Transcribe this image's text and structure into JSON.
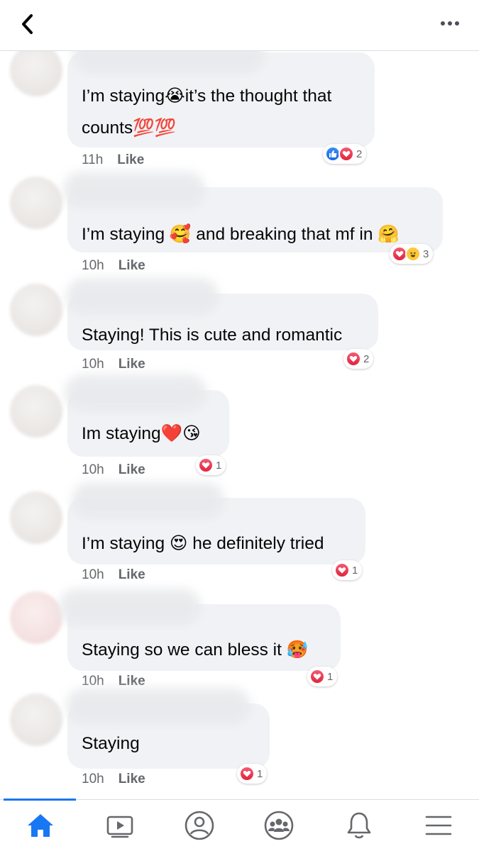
{
  "header": {
    "back_icon": "chevron-left-icon",
    "more_icon": "more-horizontal-icon"
  },
  "comments": [
    {
      "lines": [
        "I’m staying😭it’s the thought that",
        "counts💯💯"
      ],
      "time": "11h",
      "like": "Like",
      "reactions": [
        "like",
        "love"
      ],
      "count": "2"
    },
    {
      "lines": [
        "I’m staying 🥰 and breaking that mf in 🤗"
      ],
      "time": "10h",
      "like": "Like",
      "reactions": [
        "love",
        "haha"
      ],
      "count": "3"
    },
    {
      "lines": [
        "Staying! This is cute and romantic"
      ],
      "time": "10h",
      "like": "Like",
      "reactions": [
        "love"
      ],
      "count": "2"
    },
    {
      "lines": [
        "Im staying❤️😘"
      ],
      "time": "10h",
      "like": "Like",
      "reactions": [
        "love"
      ],
      "count": "1"
    },
    {
      "lines": [
        "I’m staying 😍 he definitely tried"
      ],
      "time": "10h",
      "like": "Like",
      "reactions": [
        "love"
      ],
      "count": "1"
    },
    {
      "lines": [
        "Staying so we can bless it 🥵"
      ],
      "time": "10h",
      "like": "Like",
      "reactions": [
        "love"
      ],
      "count": "1"
    },
    {
      "lines": [
        "Staying"
      ],
      "time": "10h",
      "like": "Like",
      "reactions": [
        "love"
      ],
      "count": "1"
    }
  ],
  "nav": {
    "tabs": [
      "home-icon",
      "video-icon",
      "profile-icon",
      "groups-icon",
      "bell-icon",
      "menu-icon"
    ],
    "active": "home-icon",
    "accent": "#1877f2"
  }
}
